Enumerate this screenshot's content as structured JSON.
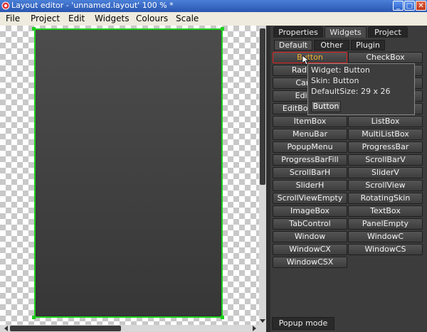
{
  "window": {
    "title": "Layout editor - 'unnamed.layout' 100 % *",
    "controls": [
      "_",
      "□",
      "✕"
    ]
  },
  "menu": [
    "File",
    "Project",
    "Edit",
    "Widgets",
    "Colours",
    "Scale"
  ],
  "panel": {
    "tabs": [
      "Properties",
      "Widgets",
      "Project"
    ],
    "active_tab": "Widgets",
    "subtabs": [
      "Default",
      "Other",
      "Plugin"
    ],
    "active_subtab": "Default",
    "widgets": [
      "Button",
      "CheckBox",
      "RadioBox",
      "",
      "Canvas",
      "",
      "EditBox",
      "",
      "EditBoxEmpty",
      "",
      "ItemBox",
      "ListBox",
      "MenuBar",
      "MultiListBox",
      "PopupMenu",
      "ProgressBar",
      "ProgressBarFill",
      "ScrollBarV",
      "ScrollBarH",
      "SliderV",
      "SliderH",
      "ScrollView",
      "ScrollViewEmpty",
      "RotatingSkin",
      "ImageBox",
      "TextBox",
      "TabControl",
      "PanelEmpty",
      "Window",
      "WindowC",
      "WindowCX",
      "WindowCS",
      "WindowCSX"
    ],
    "popup_mode_label": "Popup mode"
  },
  "tooltip": {
    "widget": "Widget: Button",
    "skin": "Skin: Button",
    "size": "DefaultSize: 29 x 26",
    "preview_label": "Button"
  },
  "colors": {
    "selection": "#1fd01f",
    "hover_text": "#f0b030",
    "hover_border": "#e02020",
    "title_bar": "#2a56b0"
  }
}
